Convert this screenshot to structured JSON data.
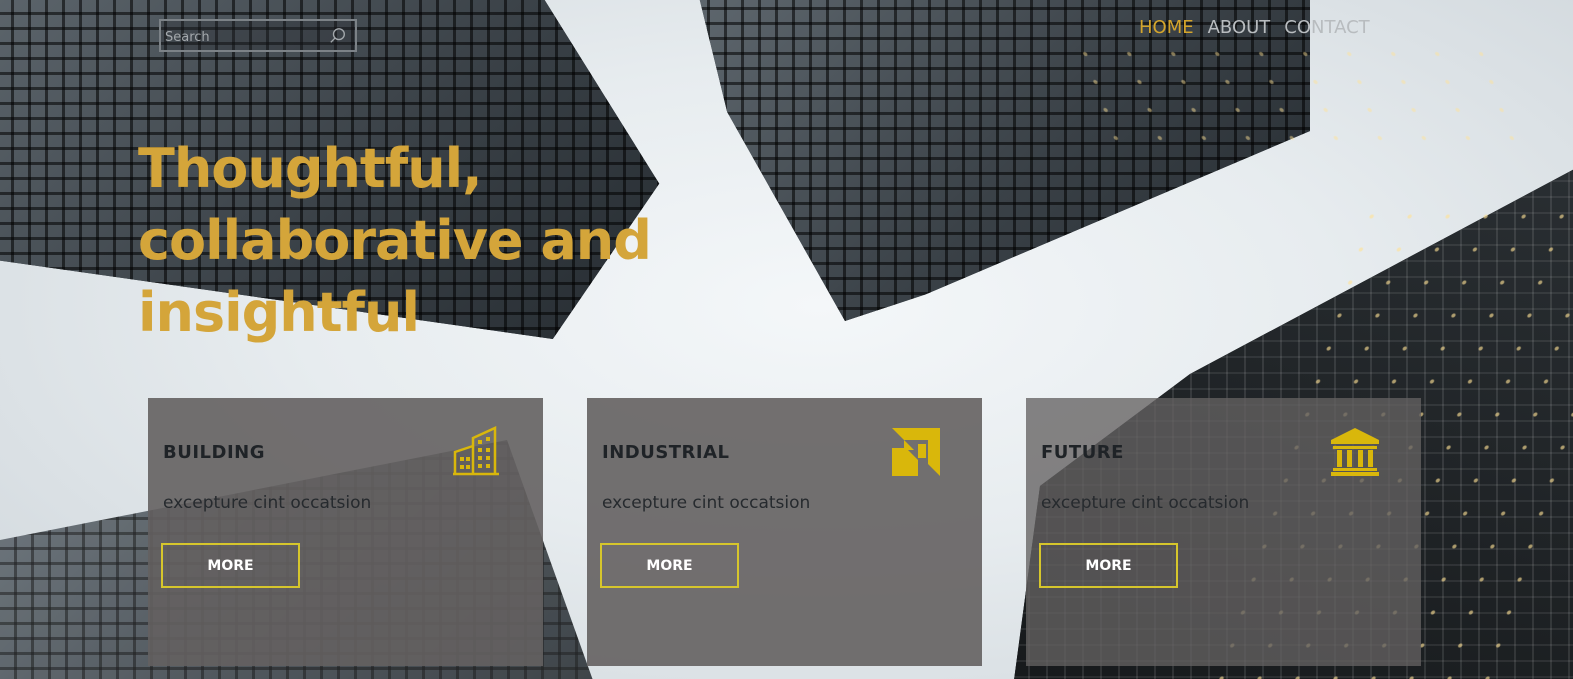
{
  "search": {
    "placeholder": "Search",
    "icon": "search-icon"
  },
  "nav": {
    "items": [
      {
        "label": "HOME",
        "active": true
      },
      {
        "label": "ABOUT",
        "active": false
      },
      {
        "label": "CONTACT",
        "active": false
      }
    ]
  },
  "hero": {
    "title": "Thoughtful, collaborative and insightful"
  },
  "cards": [
    {
      "title": "BUILDING",
      "text": "excepture cint occatsion",
      "button": "MORE",
      "icon": "building-icon"
    },
    {
      "title": "INDUSTRIAL",
      "text": "excepture cint occatsion",
      "button": "MORE",
      "icon": "arrow-logo-icon"
    },
    {
      "title": "FUTURE",
      "text": "excepture cint occatsion",
      "button": "MORE",
      "icon": "bank-icon"
    }
  ],
  "colors": {
    "accent_gold": "#d4a53a",
    "button_border": "#d6c62c",
    "icon_yellow": "#d9b70b",
    "card_bg": "#646161"
  }
}
